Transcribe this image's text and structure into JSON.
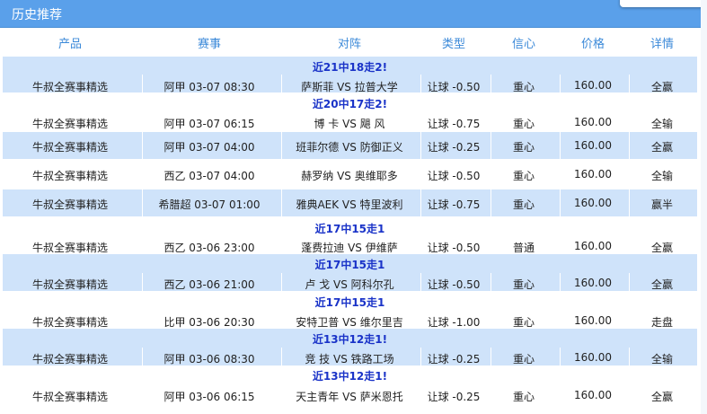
{
  "panel": {
    "title": "历史推荐"
  },
  "columns": [
    "产品",
    "赛事",
    "对阵",
    "类型",
    "信心",
    "价格",
    "详情"
  ],
  "rows": [
    {
      "tag": "近21中18走2!",
      "product": "牛叔全赛事精选",
      "match": "阿甲 03-07 08:30",
      "teams": "萨斯菲 VS 拉普大学",
      "type": "让球 -0.50",
      "confidence": "重心",
      "price": "160.00",
      "result": "全赢"
    },
    {
      "tag": "近20中17走2!",
      "product": "牛叔全赛事精选",
      "match": "阿甲 03-07 06:15",
      "teams": "博 卡 VS 飓 风",
      "type": "让球 -0.75",
      "confidence": "重心",
      "price": "160.00",
      "result": "全输"
    },
    {
      "tag": "",
      "product": "牛叔全赛事精选",
      "match": "阿甲 03-07 04:00",
      "teams": "班菲尔德 VS 防御正义",
      "type": "让球 -0.25",
      "confidence": "重心",
      "price": "160.00",
      "result": "全赢"
    },
    {
      "tag": "",
      "product": "牛叔全赛事精选",
      "match": "西乙 03-07 04:00",
      "teams": "赫罗纳 VS 奥维耶多",
      "type": "让球 -0.50",
      "confidence": "重心",
      "price": "160.00",
      "result": "全输"
    },
    {
      "tag": "",
      "product": "牛叔全赛事精选",
      "match": "希腊超 03-07 01:00",
      "teams": "雅典AEK VS 特里波利",
      "type": "让球 -0.75",
      "confidence": "重心",
      "price": "160.00",
      "result": "赢半"
    },
    {
      "tag": "近17中15走1",
      "product": "牛叔全赛事精选",
      "match": "西乙 03-06 23:00",
      "teams": "蓬费拉迪 VS 伊维萨",
      "type": "让球 -0.50",
      "confidence": "普通",
      "price": "160.00",
      "result": "全赢"
    },
    {
      "tag": "近17中15走1",
      "product": "牛叔全赛事精选",
      "match": "西乙 03-06 21:00",
      "teams": "卢 戈 VS 阿科尔孔",
      "type": "让球 -0.50",
      "confidence": "重心",
      "price": "160.00",
      "result": "全赢"
    },
    {
      "tag": "近17中15走1",
      "product": "牛叔全赛事精选",
      "match": "比甲 03-06 20:30",
      "teams": "安特卫普 VS 维尔里吉",
      "type": "让球 -1.00",
      "confidence": "重心",
      "price": "160.00",
      "result": "走盘"
    },
    {
      "tag": "近13中12走1!",
      "product": "牛叔全赛事精选",
      "match": "阿甲 03-06 08:30",
      "teams": "竞 技 VS 铁路工场",
      "type": "让球 -0.25",
      "confidence": "重心",
      "price": "160.00",
      "result": "全输"
    },
    {
      "tag": "近13中12走1!",
      "product": "牛叔全赛事精选",
      "match": "阿甲 03-06 06:15",
      "teams": "天主青年 VS 萨米恩托",
      "type": "让球 -0.25",
      "confidence": "重心",
      "price": "160.00",
      "result": "全赢"
    }
  ]
}
